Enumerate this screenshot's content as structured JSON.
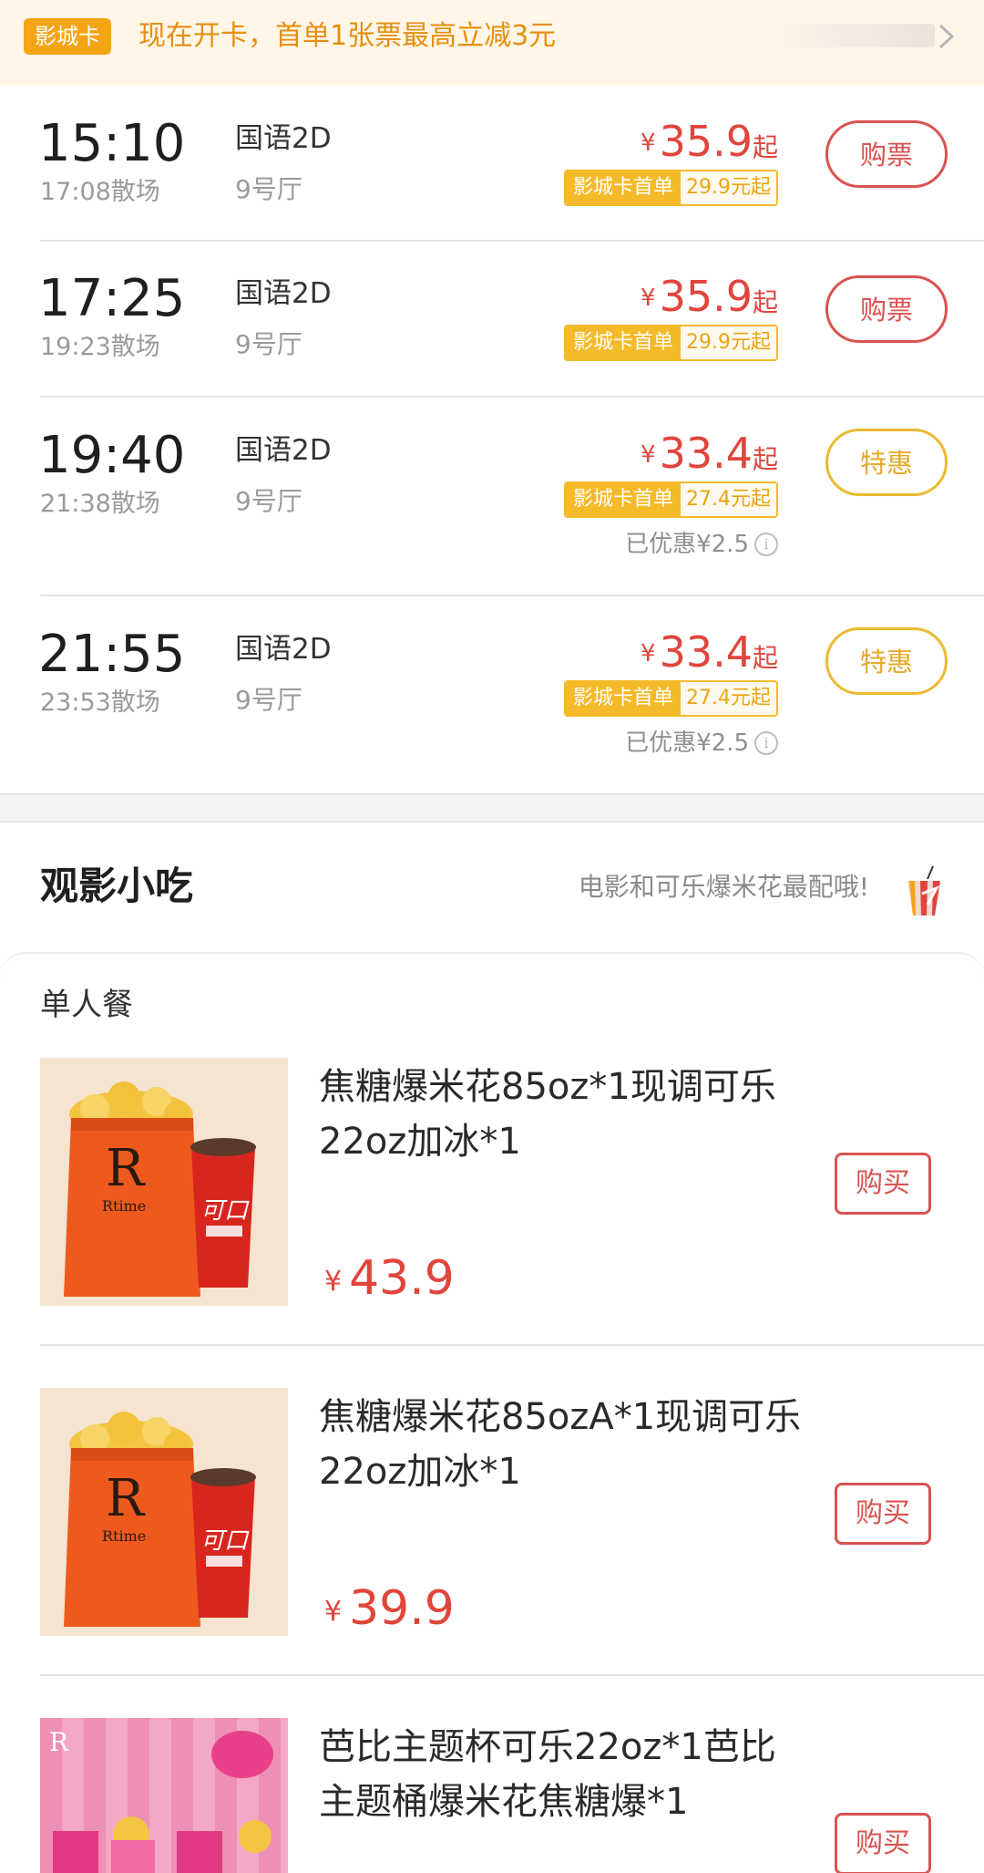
{
  "banner": {
    "badge": "影城卡",
    "text": "现在开卡，首单1张票最高立减3元",
    "arrow_icon": "chevron-right-icon"
  },
  "showtimes": [
    {
      "start": "15:10",
      "end": "17:08散场",
      "lang": "国语2D",
      "hall": "9号厅",
      "currency": "¥",
      "price": "35.9",
      "price_suffix": "起",
      "card_label": "影城卡首单",
      "card_price": "29.9元起",
      "saved": "",
      "button": "购票",
      "button_type": "buy"
    },
    {
      "start": "17:25",
      "end": "19:23散场",
      "lang": "国语2D",
      "hall": "9号厅",
      "currency": "¥",
      "price": "35.9",
      "price_suffix": "起",
      "card_label": "影城卡首单",
      "card_price": "29.9元起",
      "saved": "",
      "button": "购票",
      "button_type": "buy"
    },
    {
      "start": "19:40",
      "end": "21:38散场",
      "lang": "国语2D",
      "hall": "9号厅",
      "currency": "¥",
      "price": "33.4",
      "price_suffix": "起",
      "card_label": "影城卡首单",
      "card_price": "27.4元起",
      "saved": "已优惠¥2.5",
      "button": "特惠",
      "button_type": "deal"
    },
    {
      "start": "21:55",
      "end": "23:53散场",
      "lang": "国语2D",
      "hall": "9号厅",
      "currency": "¥",
      "price": "33.4",
      "price_suffix": "起",
      "card_label": "影城卡首单",
      "card_price": "27.4元起",
      "saved": "已优惠¥2.5",
      "button": "特惠",
      "button_type": "deal"
    }
  ],
  "snacks": {
    "title": "观影小吃",
    "subtitle": "电影和可乐爆米花最配哦!",
    "set_label": "单人餐",
    "items": [
      {
        "name": "焦糖爆米花85oz*1现调可乐22oz加冰*1",
        "currency": "¥",
        "price": "43.9",
        "button": "购买",
        "image": "popcorn-cola-image"
      },
      {
        "name": "焦糖爆米花85ozA*1现调可乐22oz加冰*1",
        "currency": "¥",
        "price": "39.9",
        "button": "购买",
        "image": "popcorn-cola-image"
      },
      {
        "name": "芭比主题杯可乐22oz*1芭比主题桶爆米花焦糖爆*1",
        "currency": "",
        "price": "",
        "button": "购买",
        "image": "barbie-combo-image"
      }
    ]
  },
  "colors": {
    "accent_red": "#e0453c",
    "accent_gold": "#f5ba2a",
    "banner_bg": "#fff6e8"
  }
}
